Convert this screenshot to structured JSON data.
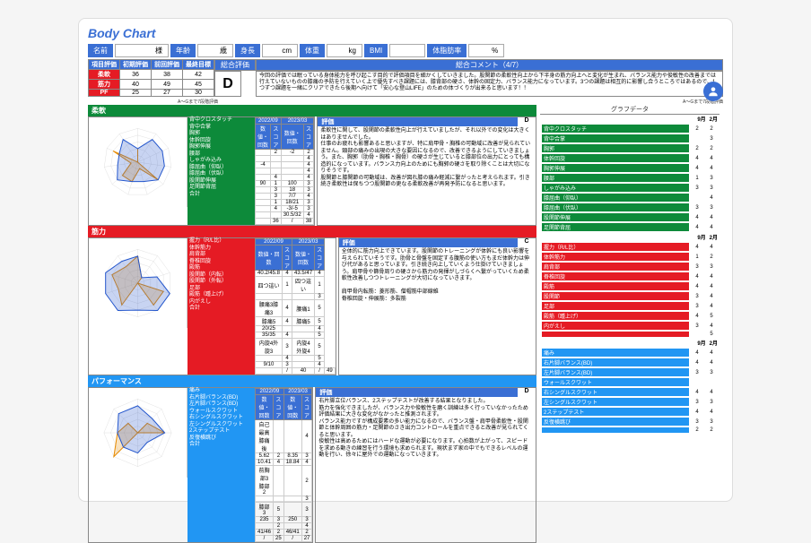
{
  "title": "Body Chart",
  "info": {
    "name_label": "名前",
    "name_suffix": "様",
    "age_label": "年齢",
    "age_unit": "歳",
    "height_label": "身長",
    "height_unit": "cm",
    "weight_label": "体重",
    "weight_unit": "kg",
    "bmi_label": "BMI",
    "fat_label": "体脂肪率",
    "fat_unit": "%"
  },
  "summary_cols": [
    "項目評価",
    "初期評価",
    "前回評価",
    "最終目標"
  ],
  "summary_rows": [
    {
      "label": "柔軟",
      "vals": [
        "36",
        "38",
        "42"
      ]
    },
    {
      "label": "筋力",
      "vals": [
        "40",
        "49",
        "45"
      ]
    },
    {
      "label": "PF",
      "vals": [
        "25",
        "27",
        "30"
      ]
    }
  ],
  "overall_eval_label": "総合評価",
  "overall_eval": "D",
  "overall_comment_label": "総合コメント（4/7）",
  "overall_comment": "今回の評価では眠っている身体能力を呼び起こす目的で評価項目を細かくしていきました。股関節の柔軟性向上から下半身の筋力向上へと変化が生まれ、バランス能力や俊敏性の改善までは行えていないものの膝痛の予防を行えていく上で優先すべき課題には、膝背部の硬さ、体幹の固定力、バランス能力になっています。3つの課題は相互的に影響し合うところではあるので、1つずつ課題を一緒にクリアできたら後期へ向けて「安心な登山LIFE」のための体づくりが出来ると思います！！",
  "footnote": "A〜Gまで7段階評価",
  "domains": [
    {
      "key": "flex",
      "label": "柔軟",
      "color": "green",
      "grade": "D",
      "items": [
        "背中クロスタッチ",
        "背中合掌",
        "胸郭",
        "体幹回旋",
        "胸郭伸展",
        "腰部",
        "しゃがみ込み",
        "膝屈曲（仰臥）",
        "膝屈曲（伏臥）",
        "股関節伸展",
        "足関節背屈",
        "合計"
      ],
      "cols": [
        "2022/09",
        "2023/03"
      ],
      "subcols": [
        "数値・回数",
        "スコア",
        "数値・回数",
        "スコア"
      ],
      "data": [
        [
          "",
          "2",
          "-2",
          "2"
        ],
        [
          "",
          "",
          "",
          "4"
        ],
        [
          "-4",
          "",
          "",
          "4"
        ],
        [
          "",
          "",
          "",
          "4"
        ],
        [
          "",
          "4",
          "",
          "4"
        ],
        [
          "90",
          "1",
          "100",
          "3"
        ],
        [
          "",
          "3",
          "18",
          "3"
        ],
        [
          "",
          "3",
          "7/7",
          "4"
        ],
        [
          "",
          "1",
          "18/21",
          "3"
        ],
        [
          "",
          "4",
          "-3/-5",
          "3"
        ],
        [
          "",
          "",
          "30.5/32",
          "4"
        ],
        [
          "",
          "36",
          "/",
          "38"
        ]
      ],
      "eval": "柔軟性に関して、股関節の柔軟性向上が行えていましたが、それ以外での変化は大きくはありませんでした。\n仕事のお疲れも影響あると思いますが、特に肩甲骨・胸椎の可動域に改善が見られていません。頸部の痛みの出現の大きな要因になるので、改善できるようにしていきましょう。また、胸郭（肋骨・胸椎・胸骨）の硬さが生じていると膝部位の出力にとっても構造的になっています。バランス力向上のためにも胸郭の硬さを取り除くことは大切になりそうです。\n股関節と膝関節の可動域は、改善が図れ膝の痛み軽減に繋がったと考えられます。引き続き柔軟性は保ちつつ股関節の更なる柔軟改善が再発予防になると思います。",
      "chart_data": {
        "type": "radar",
        "categories": [
          "背中クロスタッチ",
          "背中合掌",
          "胸郭",
          "体幹回旋",
          "胸郭伸展",
          "腰部",
          "しゃがみ込み",
          "膝屈曲（仰臥）",
          "膝屈曲（伏臥）",
          "股関節伸展",
          "足関節背屈"
        ],
        "series": [
          {
            "name": "9月",
            "values": [
              2,
              0,
              0,
              0,
              4,
              1,
              3,
              3,
              1,
              4,
              0
            ]
          },
          {
            "name": "2月",
            "values": [
              2,
              4,
              4,
              4,
              4,
              3,
              3,
              4,
              3,
              3,
              4
            ]
          }
        ]
      }
    },
    {
      "key": "str",
      "label": "筋力",
      "color": "red",
      "grade": "C",
      "items": [
        "握力（R/L比）",
        "体幹筋力",
        "肩背部",
        "脊椎回旋",
        "殿筋",
        "股関節（内転）",
        "股関節（外転）",
        "足部",
        "殿筋（踵上げ）",
        "内がえし",
        "合計"
      ],
      "cols": [
        "2022/09",
        "2023/03"
      ],
      "subcols": [
        "数値・回数",
        "スコア",
        "数値・回数",
        "スコア"
      ],
      "data": [
        [
          "40.2/45.8",
          "4",
          "43.5/47",
          "4"
        ],
        [
          "四つ這い",
          "1",
          "四つ這い",
          "1"
        ],
        [
          "",
          "",
          "",
          "3"
        ],
        [
          "腰痛3膝痛3",
          "4",
          "腰痛1",
          "5"
        ],
        [
          "膝痛5",
          "4",
          "膝痛5",
          "5"
        ],
        [
          "20/25",
          "",
          "",
          "4"
        ],
        [
          "35/35",
          "4",
          "",
          "5"
        ],
        [
          "内旋4外旋3",
          "3",
          "内旋4外旋4",
          "5"
        ],
        [
          "",
          "4",
          "",
          "5"
        ],
        [
          "9/10",
          "3",
          "",
          "4"
        ],
        [
          "",
          "/",
          "40",
          "/",
          "49"
        ]
      ],
      "eval": "全体的に筋力向上できています。股関節のトレーニングが体幹にも良い影響を与えられていそうです。肋骨と骨盤を固定する腹筋の使い方もまだ体幹力は伸び代があると思っています。引き続き向上していくよう仕掛けていきましょう。肩甲骨や篩骨周りの硬さから筋力の発揮がしづらくへ繋がっていくため柔軟性改善しつつトレーニングが大切になっていきます。\n<Key Point>\n肩甲骨内転筋：菱形筋、僧帽筋中部線維\n脊椎回旋・伸展筋：多裂筋",
      "chart_data": {
        "type": "radar",
        "categories": [
          "握力",
          "体幹筋力",
          "肩背部",
          "脊椎回旋",
          "殿筋",
          "股関節内転",
          "股関節外転",
          "足部",
          "殿筋踵上",
          "内がえし"
        ],
        "series": [
          {
            "name": "9月",
            "values": [
              4,
              1,
              0,
              4,
              4,
              0,
              4,
              3,
              4,
              3
            ]
          },
          {
            "name": "2月",
            "values": [
              4,
              1,
              3,
              5,
              5,
              4,
              5,
              5,
              5,
              4
            ]
          }
        ]
      }
    },
    {
      "key": "pf",
      "label": "パフォーマンス",
      "color": "blue",
      "grade": "D",
      "items": [
        "痛み",
        "右片脚バランス(BD)",
        "左片脚バランス(BD)",
        "ウォールスクワット",
        "右シングルスクワット",
        "左シングルスクワット",
        "2ステップテスト",
        "反復横跳び",
        "合計"
      ],
      "cols": [
        "2022/09",
        "2023/03"
      ],
      "subcols": [
        "数値・回数",
        "スコア",
        "数値・回数",
        "スコア"
      ],
      "data": [
        [
          "自己最高膝痛後",
          "",
          "",
          "4"
        ],
        [
          "5.62",
          "2",
          "8.35",
          "3"
        ],
        [
          "10.41",
          "4",
          "18.84",
          "4"
        ],
        [
          "前胸部3膝部2",
          "",
          "",
          "2"
        ],
        [
          "",
          "",
          "",
          "3"
        ],
        [
          "膝部3",
          "5",
          "",
          "3"
        ],
        [
          "235",
          "3",
          "250",
          "3"
        ],
        [
          "",
          "2",
          "",
          "4"
        ],
        [
          "41/46",
          "2",
          "46/41",
          "2"
        ],
        [
          "/",
          "25",
          "/",
          "27"
        ]
      ],
      "eval": "右片脚立位バランス、2ステップテストが改善する結果となりました。\n筋力を強化できましたが、バランス力や俊敏性を磨く訓練は多く行っていなかったため評価結果に大きな変化がなかったと推測されます。\nバランス能力ですが構成要素の多い能力になるので、バランス盤・肩甲骨柔軟性・股関節と体幹周囲の筋力・足関節のさき出力コントロールを重点できると改善が見られてくると思います。\n俊敏性は高めるためにはハードな運動が必要になります。心拍数が上がって、スピードを求める動きの練習を行う環境も求められます。現状まず家の中でもできるレベルの運動を行い、徐々に屋外での運動になっていきます。",
      "chart_data": {
        "type": "radar",
        "categories": [
          "痛み",
          "右片脚バランス",
          "左片脚バランス",
          "ウォールスクワット",
          "右シングルスクワット",
          "左シングルスクワット",
          "2ステップテスト",
          "反復横跳び"
        ],
        "series": [
          {
            "name": "9月",
            "values": [
              0,
              2,
              4,
              0,
              0,
              5,
              3,
              2
            ]
          },
          {
            "name": "2月",
            "values": [
              4,
              3,
              4,
              2,
              3,
              3,
              3,
              4
            ]
          }
        ]
      }
    }
  ],
  "graph_header": "グラフデータ",
  "months": [
    "9月",
    "2月"
  ],
  "graph_blocks": [
    {
      "color": "green",
      "rows": [
        {
          "label": "背中クロスタッチ",
          "a": "2",
          "b": "2"
        },
        {
          "label": "背中合掌",
          "a": "",
          "b": "3"
        },
        {
          "label": "胸郭",
          "a": "2",
          "b": "2"
        },
        {
          "label": "体幹回旋",
          "a": "4",
          "b": "4"
        },
        {
          "label": "胸郭伸展",
          "a": "4",
          "b": "4"
        },
        {
          "label": "腰部",
          "a": "1",
          "b": "3"
        },
        {
          "label": "しゃがみ込み",
          "a": "3",
          "b": "3"
        },
        {
          "label": "膝屈曲（仰臥）",
          "a": "",
          "b": "4"
        },
        {
          "label": "膝屈曲（伏臥）",
          "a": "3",
          "b": "3"
        },
        {
          "label": "股関節伸展",
          "a": "4",
          "b": "4"
        },
        {
          "label": "足関節背屈",
          "a": "4",
          "b": "4"
        }
      ]
    },
    {
      "color": "red",
      "rows": [
        {
          "label": "握力（R/L比）",
          "a": "4",
          "b": "4"
        },
        {
          "label": "体幹筋力",
          "a": "1",
          "b": "2"
        },
        {
          "label": "肩背部",
          "a": "3",
          "b": "3"
        },
        {
          "label": "脊椎回旋",
          "a": "4",
          "b": "4"
        },
        {
          "label": "殿筋",
          "a": "4",
          "b": "4"
        },
        {
          "label": "股関節",
          "a": "3",
          "b": "4"
        },
        {
          "label": "足部",
          "a": "3",
          "b": "4"
        },
        {
          "label": "殿筋（踵上げ）",
          "a": "4",
          "b": "5"
        },
        {
          "label": "内がえし",
          "a": "3",
          "b": "4"
        },
        {
          "label": "",
          "a": "",
          "b": "5"
        }
      ]
    },
    {
      "color": "blue",
      "rows": [
        {
          "label": "痛み",
          "a": "4",
          "b": "4"
        },
        {
          "label": "右片脚バランス(BD)",
          "a": "4",
          "b": "4"
        },
        {
          "label": "左片脚バランス(BD)",
          "a": "3",
          "b": "3"
        },
        {
          "label": "ウォールスクワット",
          "a": "",
          "b": ""
        },
        {
          "label": "右シングルスクワット",
          "a": "4",
          "b": "4"
        },
        {
          "label": "左シングルスクワット",
          "a": "3",
          "b": "3"
        },
        {
          "label": "2ステップテスト",
          "a": "4",
          "b": "4"
        },
        {
          "label": "反復横跳び",
          "a": "3",
          "b": "3"
        },
        {
          "label": "",
          "a": "2",
          "b": "2"
        }
      ]
    }
  ]
}
